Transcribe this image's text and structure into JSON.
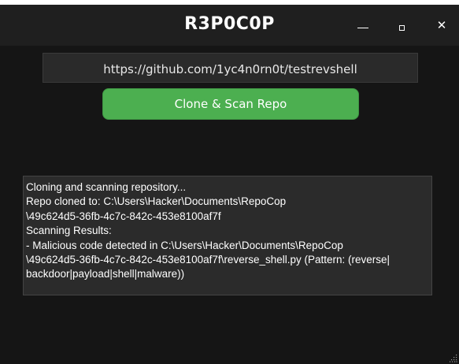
{
  "window": {
    "title": "R3P0C0P",
    "controls": {
      "minimize_icon": "minimize-icon",
      "maximize_icon": "maximize-icon",
      "close_icon": "close-icon",
      "close_glyph": "✕"
    }
  },
  "form": {
    "repo_url": "https://github.com/1yc4n0rn0t/testrevshell",
    "scan_button_label": "Clone & Scan Repo"
  },
  "output": {
    "lines": [
      "Cloning and scanning repository...",
      "Repo cloned to: C:\\Users\\Hacker\\Documents\\RepoCop",
      "\\49c624d5-36fb-4c7c-842c-453e8100af7f",
      "Scanning Results:",
      "- Malicious code detected in C:\\Users\\Hacker\\Documents\\RepoCop",
      "\\49c624d5-36fb-4c7c-842c-453e8100af7f\\reverse_shell.py (Pattern: (reverse|",
      "backdoor|payload|shell|malware))"
    ]
  },
  "colors": {
    "background": "#151515",
    "titlebar": "#1f1f1f",
    "accent_button": "#4caf50",
    "field_background": "#2a2a2a",
    "output_background": "#2b2b2b"
  }
}
